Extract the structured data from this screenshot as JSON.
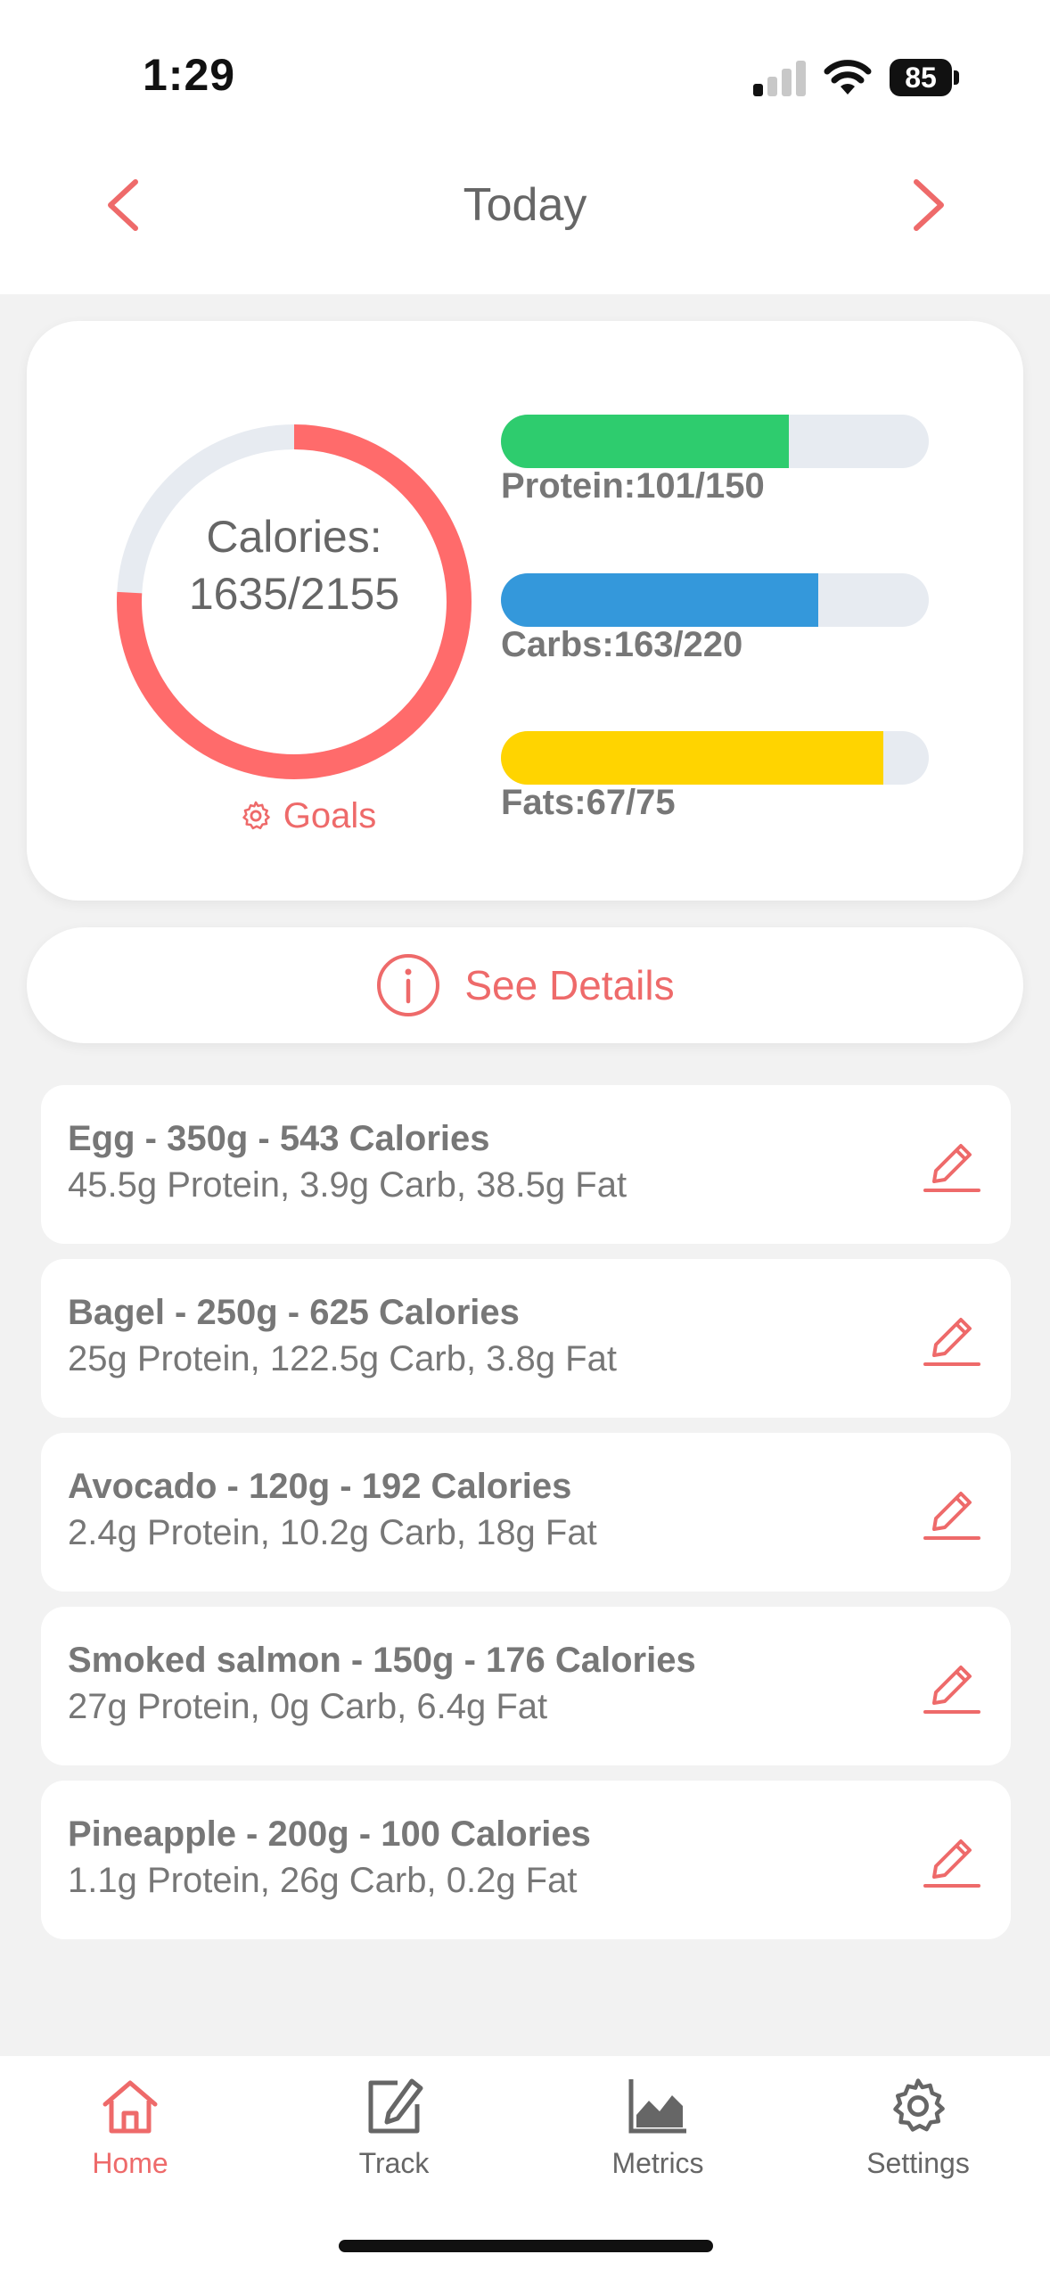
{
  "status_bar": {
    "time": "1:29",
    "battery": "85"
  },
  "header": {
    "title": "Today"
  },
  "summary": {
    "calories_label": "Calories:",
    "calories_value": "1635/2155",
    "calories_consumed": 1635,
    "calories_goal": 2155,
    "goals_label": "Goals",
    "macros": [
      {
        "label": "Protein:101/150",
        "value": 101,
        "goal": 150,
        "color": "#2ecc6e"
      },
      {
        "label": "Carbs:163/220",
        "value": 163,
        "goal": 220,
        "color": "#3498db"
      },
      {
        "label": "Fats:67/75",
        "value": 67,
        "goal": 75,
        "color": "#ffd400"
      }
    ],
    "ring_color": "#ff6b6b",
    "ring_track_color": "#e7ebf1"
  },
  "details_button": {
    "label": "See Details"
  },
  "foods": [
    {
      "name": "Egg - 350g - 543 Calories",
      "macros": "45.5g Protein, 3.9g Carb, 38.5g Fat"
    },
    {
      "name": "Bagel - 250g - 625 Calories",
      "macros": "25g Protein, 122.5g Carb, 3.8g Fat"
    },
    {
      "name": "Avocado - 120g - 192 Calories",
      "macros": "2.4g Protein, 10.2g Carb, 18g Fat"
    },
    {
      "name": "Smoked salmon - 150g - 176 Calories",
      "macros": "27g Protein, 0g Carb, 6.4g Fat"
    },
    {
      "name": "Pineapple - 200g - 100 Calories",
      "macros": "1.1g Protein, 26g Carb, 0.2g Fat"
    }
  ],
  "tabs": [
    {
      "label": "Home",
      "icon": "home-icon",
      "active": true
    },
    {
      "label": "Track",
      "icon": "edit-square-icon",
      "active": false
    },
    {
      "label": "Metrics",
      "icon": "area-chart-icon",
      "active": false
    },
    {
      "label": "Settings",
      "icon": "gear-icon",
      "active": false
    }
  ],
  "colors": {
    "accent": "#ee6a6a"
  }
}
